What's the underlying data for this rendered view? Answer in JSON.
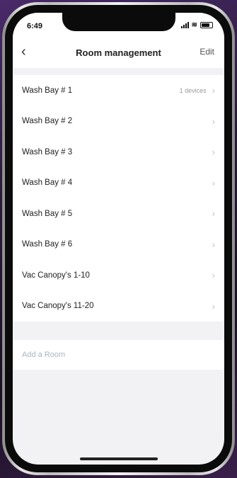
{
  "status_bar": {
    "time": "6:49"
  },
  "nav": {
    "back_icon": "chevron-left-icon",
    "title": "Room management",
    "edit_label": "Edit"
  },
  "rooms": [
    {
      "name": "Wash Bay # 1",
      "meta": "1 devices"
    },
    {
      "name": "Wash Bay # 2",
      "meta": ""
    },
    {
      "name": "Wash Bay # 3",
      "meta": ""
    },
    {
      "name": "Wash Bay # 4",
      "meta": ""
    },
    {
      "name": "Wash Bay # 5",
      "meta": ""
    },
    {
      "name": "Wash Bay # 6",
      "meta": ""
    },
    {
      "name": "Vac Canopy's 1-10",
      "meta": ""
    },
    {
      "name": "Vac Canopy's 11-20",
      "meta": ""
    }
  ],
  "add_room": {
    "label": "Add a Room"
  }
}
